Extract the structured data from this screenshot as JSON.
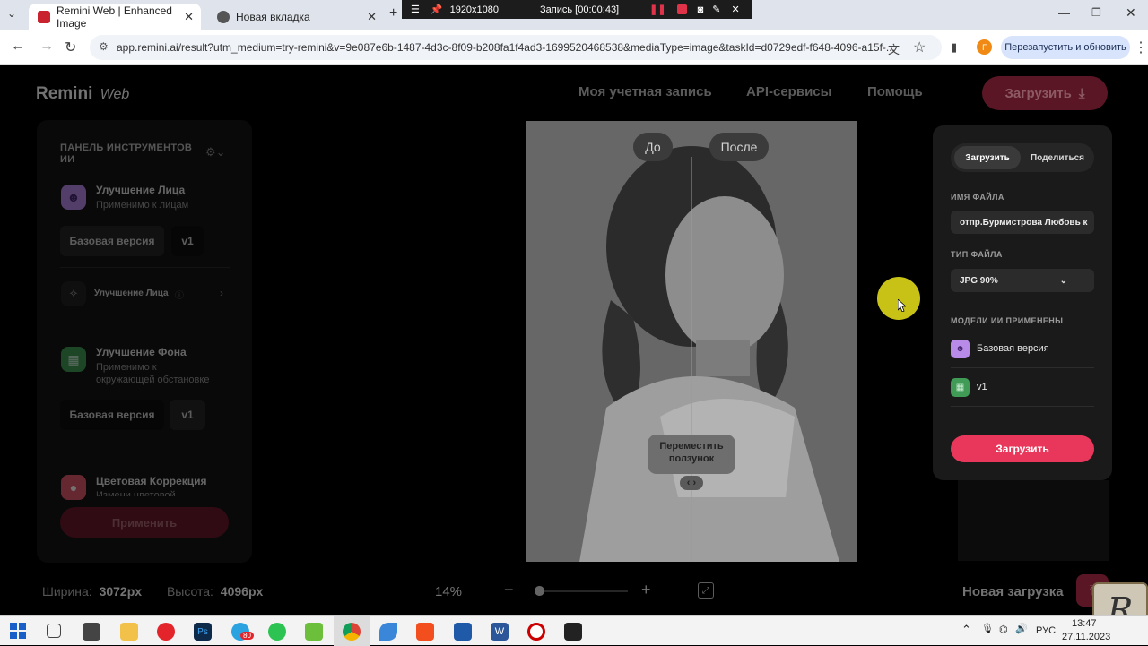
{
  "browser": {
    "tabs": [
      {
        "title": "Remini Web | Enhanced Image"
      },
      {
        "title": "Новая вкладка"
      }
    ],
    "url": "app.remini.ai/result?utm_medium=try-remini&v=9e087e6b-1487-4d3c-8f09-b208fa1f4ad3-1699520468538&mediaType=image&taskId=d0729edf-f648-4096-a15f-...",
    "relaunch_label": "Перезапустить и обновить",
    "profile_initial": "Г"
  },
  "recorder": {
    "resolution": "1920x1080",
    "status": "Запись [00:00:43]"
  },
  "header": {
    "logo": "Remini",
    "logo_sub": "Web",
    "nav": [
      "Моя учетная запись",
      "API-сервисы",
      "Помощь"
    ],
    "upload_label": "Загрузить"
  },
  "sidebar": {
    "title": "ПАНЕЛЬ ИНСТРУМЕНТОВ ИИ",
    "face": {
      "title": "Улучшение Лица",
      "subtitle": "Применимо к лицам",
      "version": "Базовая версия",
      "model": "v1"
    },
    "face_extra": "Улучшение Лица",
    "background": {
      "title": "Улучшение Фона",
      "subtitle_1": "Применимо к",
      "subtitle_2": "окружающей обстановке",
      "version": "Базовая версия",
      "model": "v1"
    },
    "color": {
      "title": "Цветовая Коррекция",
      "subtitle": "Измени цветовой"
    },
    "apply_label": "Применить"
  },
  "viewer": {
    "before_label": "До",
    "after_label": "После",
    "hint_line1": "Переместить",
    "hint_line2": "ползунок",
    "hint_arrows": "‹ ›"
  },
  "download_panel": {
    "tab_download": "Загрузить",
    "tab_share": "Поделиться",
    "filename_caption": "ИМЯ ФАЙЛА",
    "filename_value": "отпр.Бурмистрова Любовь к",
    "filetype_caption": "ТИП ФАЙЛА",
    "filetype_value": "JPG 90%",
    "models_caption": "МОДЕЛИ ИИ ПРИМЕНЕНЫ",
    "models": [
      "Базовая версия",
      "v1"
    ],
    "download_button": "Загрузить"
  },
  "bottom": {
    "width_label": "Ширина:",
    "width_value": "3072px",
    "height_label": "Высота:",
    "height_value": "4096px",
    "zoom": "14%",
    "zoom_level": 0.05,
    "new_upload": "Новая загрузка"
  },
  "taskbar": {
    "language": "РУС",
    "time": "13:47",
    "date": "27.11.2023",
    "telegram_badge": "80"
  },
  "colors": {
    "accent": "#e8375a",
    "cursor_highlight": "#c7c215"
  }
}
